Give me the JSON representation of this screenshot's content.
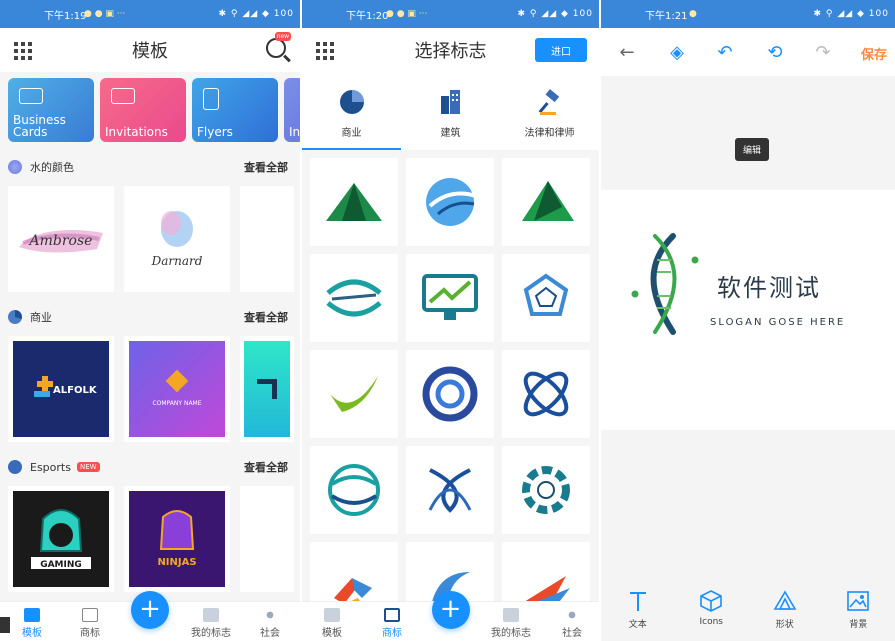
{
  "status": {
    "left_time": "下午1:19",
    "mid_time": "下午1:20",
    "right_time": "下午1:21",
    "right_icons": "✱ ⚲ ◢◢ ◆ 100"
  },
  "templates": {
    "title": "模板",
    "search_badge": "new",
    "categories": [
      {
        "label": "Business Cards",
        "color_from": "#4fb0e6",
        "color_to": "#3a7bd5"
      },
      {
        "label": "Invitations",
        "color_from": "#f76b8a",
        "color_to": "#f0508f"
      },
      {
        "label": "Flyers",
        "color_from": "#3fa5e8",
        "color_to": "#2f6fd6"
      },
      {
        "label": "In",
        "color_from": "#7a8fe8",
        "color_to": "#6a7ce0"
      }
    ],
    "sections": [
      {
        "title": "水的颜色",
        "more": "查看全部",
        "items": [
          "Ambrose",
          "Darnard"
        ]
      },
      {
        "title": "商业",
        "more": "查看全部",
        "items": [
          "ALFOLK",
          "COMPANY NAME"
        ]
      },
      {
        "title": "Esports",
        "badge": "NEW",
        "more": "查看全部",
        "items": [
          "GAMING",
          "NINJAS"
        ]
      }
    ],
    "nav": [
      "模板",
      "商标",
      "我的标志",
      "社会"
    ]
  },
  "industry": {
    "title": "选择标志",
    "enter_label": "进口",
    "tabs": [
      {
        "label": "商业",
        "icon": "pie-chart-icon"
      },
      {
        "label": "建筑",
        "icon": "buildings-icon"
      },
      {
        "label": "法律和律师",
        "icon": "gavel-icon"
      }
    ],
    "nav": [
      "模板",
      "商标",
      "我的标志",
      "社会"
    ]
  },
  "editor": {
    "save_label": "保存",
    "tooltip": "编辑",
    "brand_name": "软件测试",
    "slogan": "SLOGAN GOSE HERE",
    "tools": [
      "文本",
      "Icons",
      "形状",
      "背景"
    ]
  },
  "colors": {
    "accent": "#1890ff",
    "save": "#ff8a3d",
    "status_bar": "#3a86d8"
  }
}
